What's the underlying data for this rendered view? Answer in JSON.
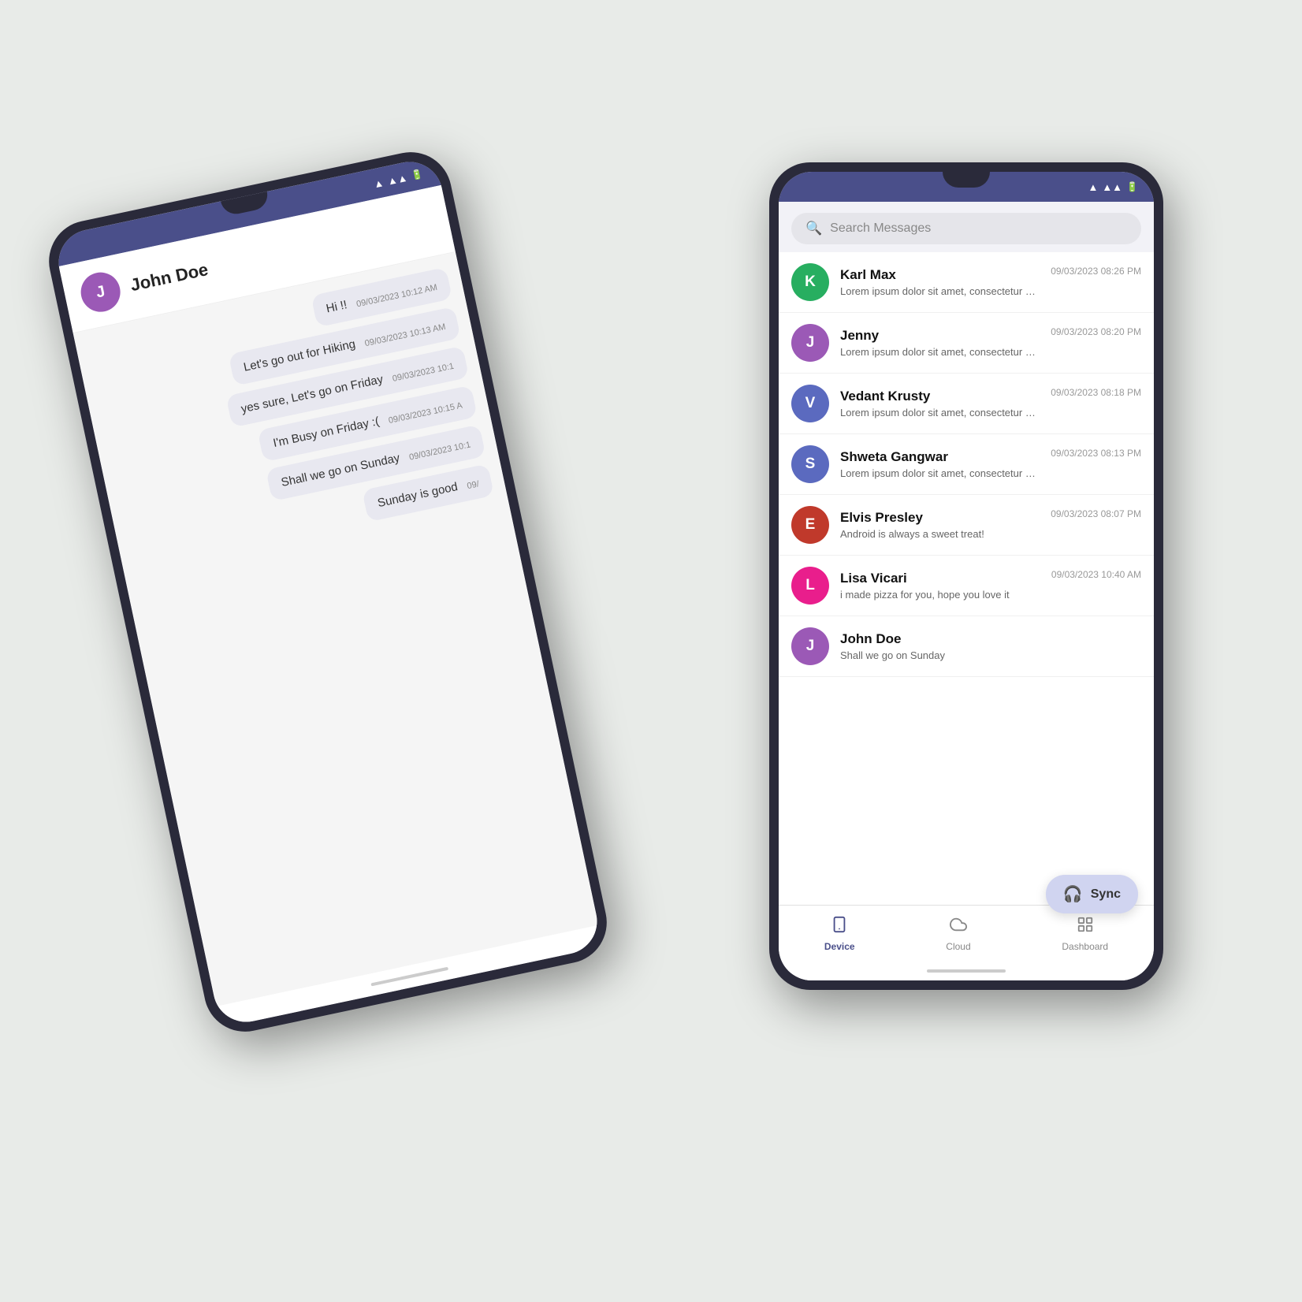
{
  "left_phone": {
    "status_bar": {
      "signal": "▲▲▲",
      "wifi": "▲",
      "battery": "▓"
    },
    "header": {
      "avatar_letter": "J",
      "avatar_color": "#9b59b6",
      "name": "John Doe"
    },
    "messages": [
      {
        "text": "Hi !!",
        "time": "09/03/2023 10:12 AM",
        "align": "right"
      },
      {
        "text": "Let's go out for Hiking",
        "time": "09/03/2023 10:13 AM",
        "align": "right"
      },
      {
        "text": "yes sure, Let's go on Friday",
        "time": "09/03/2023 10:1",
        "align": "right"
      },
      {
        "text": "I'm Busy on Friday :(",
        "time": "09/03/2023 10:15 A",
        "align": "right"
      },
      {
        "text": "Shall we go on Sunday",
        "time": "09/03/2023 10:1",
        "align": "right"
      },
      {
        "text": "Sunday is good",
        "time": "09/",
        "align": "right"
      }
    ]
  },
  "right_phone": {
    "search": {
      "placeholder": "Search Messages"
    },
    "contacts": [
      {
        "letter": "K",
        "color": "#27ae60",
        "name": "Karl Max",
        "preview": "Lorem ipsum dolor sit amet, consectetur adipiscing",
        "time": "09/03/2023 08:26 PM"
      },
      {
        "letter": "J",
        "color": "#9b59b6",
        "name": "Jenny",
        "preview": "Lorem ipsum dolor sit amet, consectetur adipiscing",
        "time": "09/03/2023 08:20 PM"
      },
      {
        "letter": "V",
        "color": "#5b6abf",
        "name": "Vedant Krusty",
        "preview": "Lorem ipsum dolor sit amet, consectetur adipiscing",
        "time": "09/03/2023 08:18 PM"
      },
      {
        "letter": "S",
        "color": "#5b6abf",
        "name": "Shweta Gangwar",
        "preview": "Lorem ipsum dolor sit amet, consectetur adipiscing",
        "time": "09/03/2023 08:13 PM"
      },
      {
        "letter": "E",
        "color": "#c0392b",
        "name": "Elvis Presley",
        "preview": "Android is always a sweet treat!",
        "time": "09/03/2023 08:07 PM"
      },
      {
        "letter": "L",
        "color": "#e91e8c",
        "name": "Lisa Vicari",
        "preview": "i made pizza for you, hope you love it",
        "time": "09/03/2023 10:40 AM"
      },
      {
        "letter": "J",
        "color": "#9b59b6",
        "name": "John Doe",
        "preview": "Shall we go on Sunday",
        "time": ""
      }
    ],
    "sync_button": {
      "label": "Sync"
    },
    "nav": [
      {
        "label": "Device",
        "active": true,
        "icon": "📱"
      },
      {
        "label": "Cloud",
        "active": false,
        "icon": "☁"
      },
      {
        "label": "Dashboard",
        "active": false,
        "icon": "⊞"
      }
    ]
  }
}
